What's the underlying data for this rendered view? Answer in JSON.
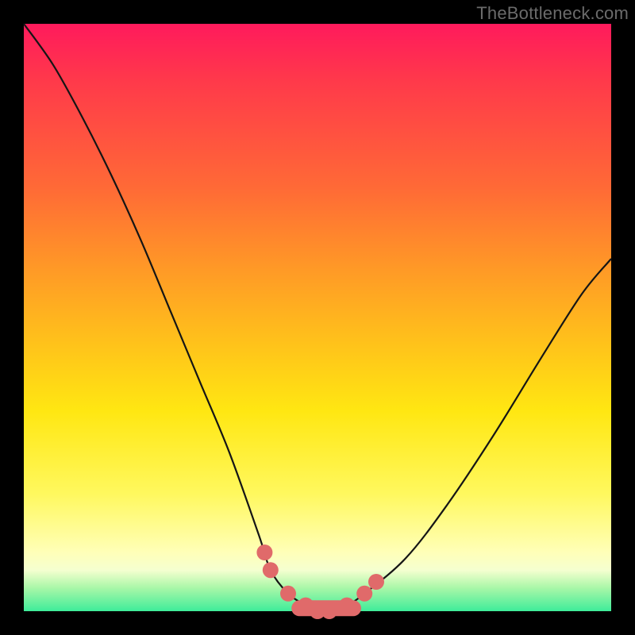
{
  "watermark": "TheBottleneck.com",
  "chart_data": {
    "type": "line",
    "title": "",
    "xlabel": "",
    "ylabel": "",
    "xlim": [
      0,
      1
    ],
    "ylim": [
      0,
      1
    ],
    "series": [
      {
        "name": "bottleneck-curve",
        "x": [
          0.0,
          0.05,
          0.1,
          0.15,
          0.2,
          0.25,
          0.3,
          0.35,
          0.4,
          0.42,
          0.45,
          0.48,
          0.5,
          0.52,
          0.55,
          0.58,
          0.65,
          0.72,
          0.8,
          0.88,
          0.95,
          1.0
        ],
        "values": [
          1.0,
          0.93,
          0.84,
          0.74,
          0.63,
          0.51,
          0.39,
          0.27,
          0.13,
          0.07,
          0.03,
          0.01,
          0.0,
          0.0,
          0.01,
          0.03,
          0.09,
          0.18,
          0.3,
          0.43,
          0.54,
          0.6
        ]
      }
    ],
    "markers": {
      "name": "highlight-points",
      "color": "#e06a6a",
      "x": [
        0.41,
        0.42,
        0.45,
        0.48,
        0.5,
        0.52,
        0.55,
        0.58,
        0.6
      ],
      "values": [
        0.1,
        0.07,
        0.03,
        0.01,
        0.0,
        0.0,
        0.01,
        0.03,
        0.05
      ]
    }
  }
}
